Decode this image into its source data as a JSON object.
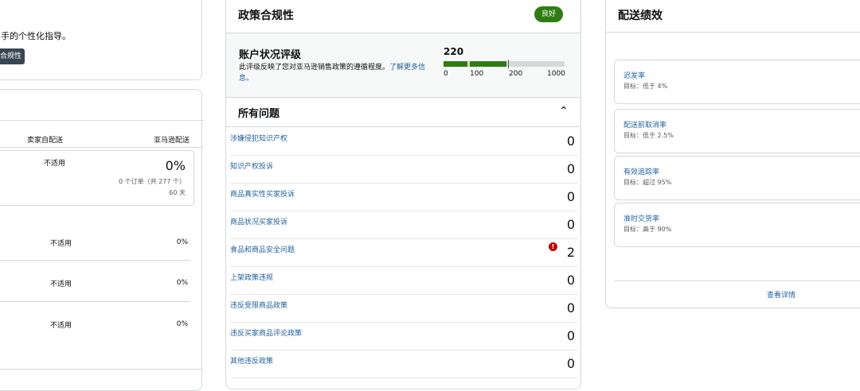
{
  "left_top": {
    "guidance_text": "手的个性化指导。",
    "button_label": "合规性"
  },
  "left_main": {
    "col_seller": "卖家自配送",
    "col_amazon": "亚马逊配送",
    "summary_seller": "不适用",
    "summary_pct": "0%",
    "summary_orders": "0 个订单（共 277 个）",
    "summary_days": "60 天",
    "rows": [
      {
        "seller": "不适用",
        "amazon": "0%"
      },
      {
        "seller": "不适用",
        "amazon": "0%"
      },
      {
        "seller": "不适用",
        "amazon": "0%"
      }
    ]
  },
  "policy": {
    "title": "政策合规性",
    "badge": "良好",
    "rating_title": "账户状况评级",
    "rating_desc": "此评级反映了您对亚马逊销售政策的遵循程度。",
    "rating_link": "了解更多信息。",
    "score": "220",
    "score_value": 220,
    "ticks": [
      "0",
      "100",
      "200",
      "1000"
    ],
    "issues_title": "所有问题",
    "issues": [
      {
        "label": "涉嫌侵犯知识产权",
        "count": "0"
      },
      {
        "label": "知识产权投诉",
        "count": "0"
      },
      {
        "label": "商品真实性买家投诉",
        "count": "0"
      },
      {
        "label": "商品状况买家投诉",
        "count": "0"
      },
      {
        "label": "食品和商品安全问题",
        "count": "2",
        "alert": true
      },
      {
        "label": "上架政策违规",
        "count": "0"
      },
      {
        "label": "违反受限商品政策",
        "count": "0"
      },
      {
        "label": "违反买家商品评论政策",
        "count": "0"
      },
      {
        "label": "其他违反政策",
        "count": "0"
      }
    ]
  },
  "shipping": {
    "title": "配送绩效",
    "metrics": [
      {
        "name": "迟发率",
        "target": "目标：低于 4%"
      },
      {
        "name": "配送前取消率",
        "target": "目标：低于 2.5%"
      },
      {
        "name": "有效追踪率",
        "target": "目标：超过 95%"
      },
      {
        "name": "准时交货率",
        "target": "目标：高于 90%"
      }
    ],
    "details_link": "查看详情"
  },
  "colors": {
    "good": "#2f7d12",
    "link": "#2162a1",
    "alert": "#c40000"
  }
}
